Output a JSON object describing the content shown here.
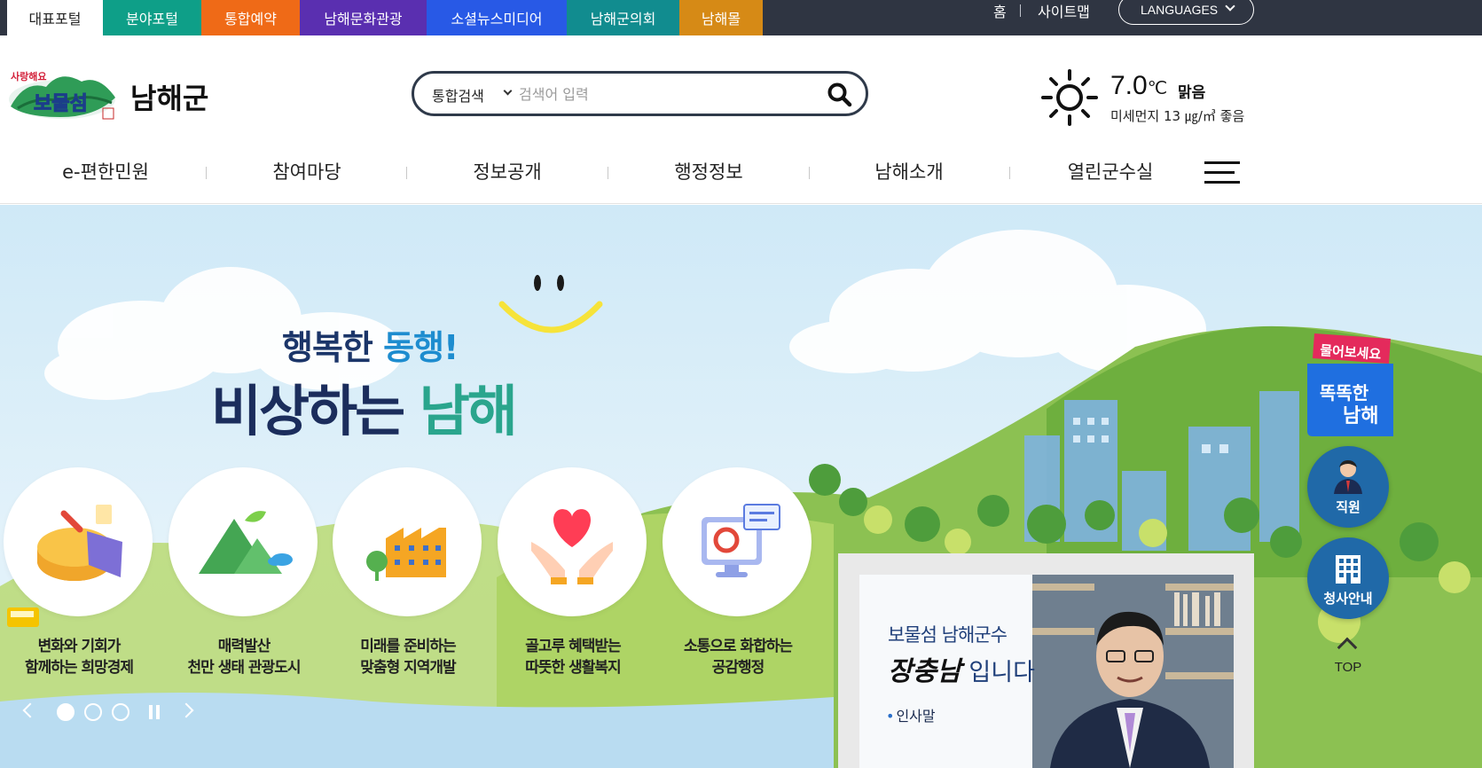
{
  "site_tabs": [
    {
      "label": "대표포털",
      "color": "#ffffff",
      "active": true
    },
    {
      "label": "분야포털",
      "color": "#0e9f88"
    },
    {
      "label": "통합예약",
      "color": "#ef6a17"
    },
    {
      "label": "남해문화관광",
      "color": "#5a2fb0"
    },
    {
      "label": "소셜뉴스미디어",
      "color": "#2859e6"
    },
    {
      "label": "남해군의회",
      "color": "#118c8f"
    },
    {
      "label": "남해몰",
      "color": "#d68a16"
    }
  ],
  "util": {
    "home": "홈",
    "sitemap": "사이트맵",
    "languages": "LANGUAGES"
  },
  "header": {
    "logo_name": "남해군",
    "logo_slogan_art": "사랑해요 보물섬",
    "search": {
      "scope": "통합검색",
      "placeholder": "검색어 입력",
      "value": ""
    },
    "weather": {
      "icon": "sun-icon",
      "temp": "7.0",
      "unit": "℃",
      "sky": "맑음",
      "dust": "미세먼지 13 ㎍/㎥ 좋음"
    }
  },
  "gnb": [
    "e-편한민원",
    "참여마당",
    "정보공개",
    "행정정보",
    "남해소개",
    "열린군수실"
  ],
  "hero": {
    "slogan_line1_a": "행복한 ",
    "slogan_line1_b": "동행!",
    "slogan_line2_a": "비상하는 ",
    "slogan_line2_b": "남해",
    "visions": [
      {
        "icon": "pie-chart-icon",
        "line1": "변화와 기회가",
        "line2": "함께하는 희망경제"
      },
      {
        "icon": "mountain-icon",
        "line1": "매력발산",
        "line2": "천만 생태 관광도시"
      },
      {
        "icon": "factory-icon",
        "line1": "미래를 준비하는",
        "line2": "맞춤형 지역개발"
      },
      {
        "icon": "heart-hands-icon",
        "line1": "골고루 혜택받는",
        "line2": "따뜻한 생활복지"
      },
      {
        "icon": "monitor-icon",
        "line1": "소통으로 화합하는",
        "line2": "공감행정"
      }
    ],
    "slide_dots": 3,
    "active_dot": 0
  },
  "mayor": {
    "title": "보물섬 남해군수",
    "name": "장충남",
    "name_suffix": " 입니다",
    "link": "인사말"
  },
  "quick": {
    "ask_top": "물어보세요",
    "ask_main_1": "똑똑한",
    "ask_main_2": "남해",
    "staff": "직원",
    "building": "청사안내",
    "top": "TOP"
  }
}
